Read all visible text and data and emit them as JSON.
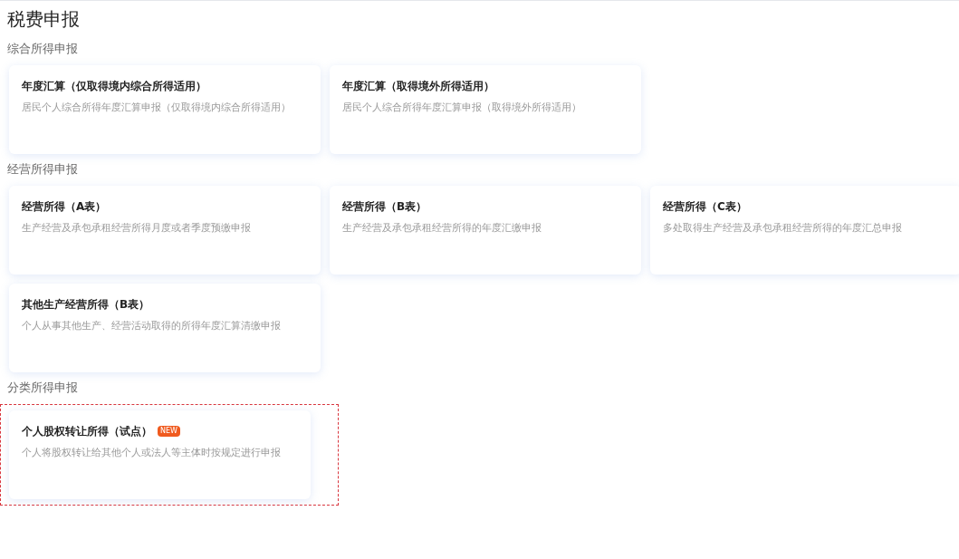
{
  "page_title": "税费申报",
  "sections": [
    {
      "heading": "综合所得申报",
      "cards": [
        {
          "title": "年度汇算（仅取得境内综合所得适用）",
          "description": "居民个人综合所得年度汇算申报（仅取得境内综合所得适用）",
          "highlighted": false
        },
        {
          "title": "年度汇算（取得境外所得适用）",
          "description": "居民个人综合所得年度汇算申报（取得境外所得适用）",
          "highlighted": false
        }
      ]
    },
    {
      "heading": "经营所得申报",
      "cards": [
        {
          "title": "经营所得（A表）",
          "description": "生产经营及承包承租经营所得月度或者季度预缴申报",
          "highlighted": false
        },
        {
          "title": "经营所得（B表）",
          "description": "生产经营及承包承租经营所得的年度汇缴申报",
          "highlighted": false
        },
        {
          "title": "经营所得（C表）",
          "description": "多处取得生产经营及承包承租经营所得的年度汇总申报",
          "highlighted": false
        },
        {
          "title": "其他生产经营所得（B表）",
          "description": "个人从事其他生产、经营活动取得的所得年度汇算清缴申报",
          "highlighted": false
        }
      ]
    },
    {
      "heading": "分类所得申报",
      "cards": [
        {
          "title": "个人股权转让所得（试点）",
          "badge": "NEW",
          "description": "个人将股权转让给其他个人或法人等主体时按规定进行申报",
          "highlighted": true
        }
      ]
    }
  ]
}
